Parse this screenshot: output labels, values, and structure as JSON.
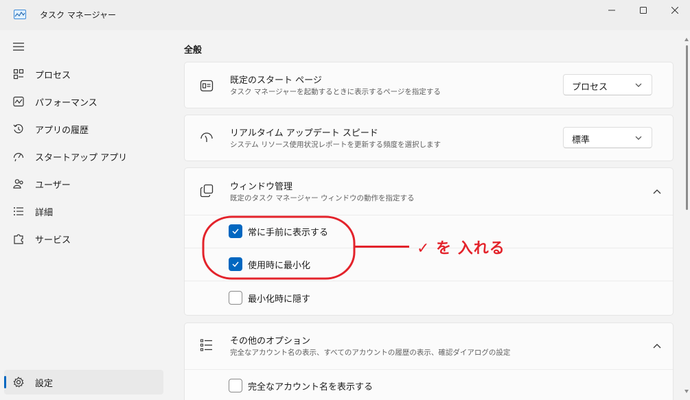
{
  "window": {
    "title": "タスク マネージャー",
    "icon": "performance-graph-icon",
    "controls": [
      "minimize-icon",
      "maximize-icon",
      "close-icon"
    ]
  },
  "sidebar": {
    "menu_icon": "hamburger-icon",
    "items": [
      {
        "label": "プロセス",
        "icon": "processes-grid-icon"
      },
      {
        "label": "パフォーマンス",
        "icon": "performance-chart-icon"
      },
      {
        "label": "アプリの履歴",
        "icon": "history-icon"
      },
      {
        "label": "スタートアップ アプリ",
        "icon": "startup-speedometer-icon"
      },
      {
        "label": "ユーザー",
        "icon": "users-icon"
      },
      {
        "label": "詳細",
        "icon": "details-list-icon"
      },
      {
        "label": "サービス",
        "icon": "services-puzzle-icon"
      }
    ],
    "settings": {
      "label": "設定",
      "icon": "gear-icon",
      "active": true
    }
  },
  "main": {
    "section_title": "全般",
    "default_page": {
      "title": "既定のスタート ページ",
      "description": "タスク マネージャーを起動するときに表示するページを指定する",
      "value": "プロセス"
    },
    "update_speed": {
      "title": "リアルタイム アップデート スピード",
      "description": "システム リソース使用状況レポートを更新する頻度を選択します",
      "value": "標準"
    },
    "window_management": {
      "title": "ウィンドウ管理",
      "description": "既定のタスク マネージャー ウィンドウの動作を指定する",
      "options": [
        {
          "label": "常に手前に表示する",
          "checked": true
        },
        {
          "label": "使用時に最小化",
          "checked": true
        },
        {
          "label": "最小化時に隠す",
          "checked": false
        }
      ]
    },
    "other_options": {
      "title": "その他のオプション",
      "description": "完全なアカウント名の表示、すべてのアカウントの履歴の表示、確認ダイアログの設定",
      "options": [
        {
          "label": "完全なアカウント名を表示する",
          "checked": false
        }
      ]
    }
  },
  "annotation": {
    "text": "✓ を 入れる",
    "color": "#e3232b"
  },
  "colors": {
    "accent": "#0067c0",
    "background": "#f3f3f3",
    "card": "#fbfbfb"
  }
}
